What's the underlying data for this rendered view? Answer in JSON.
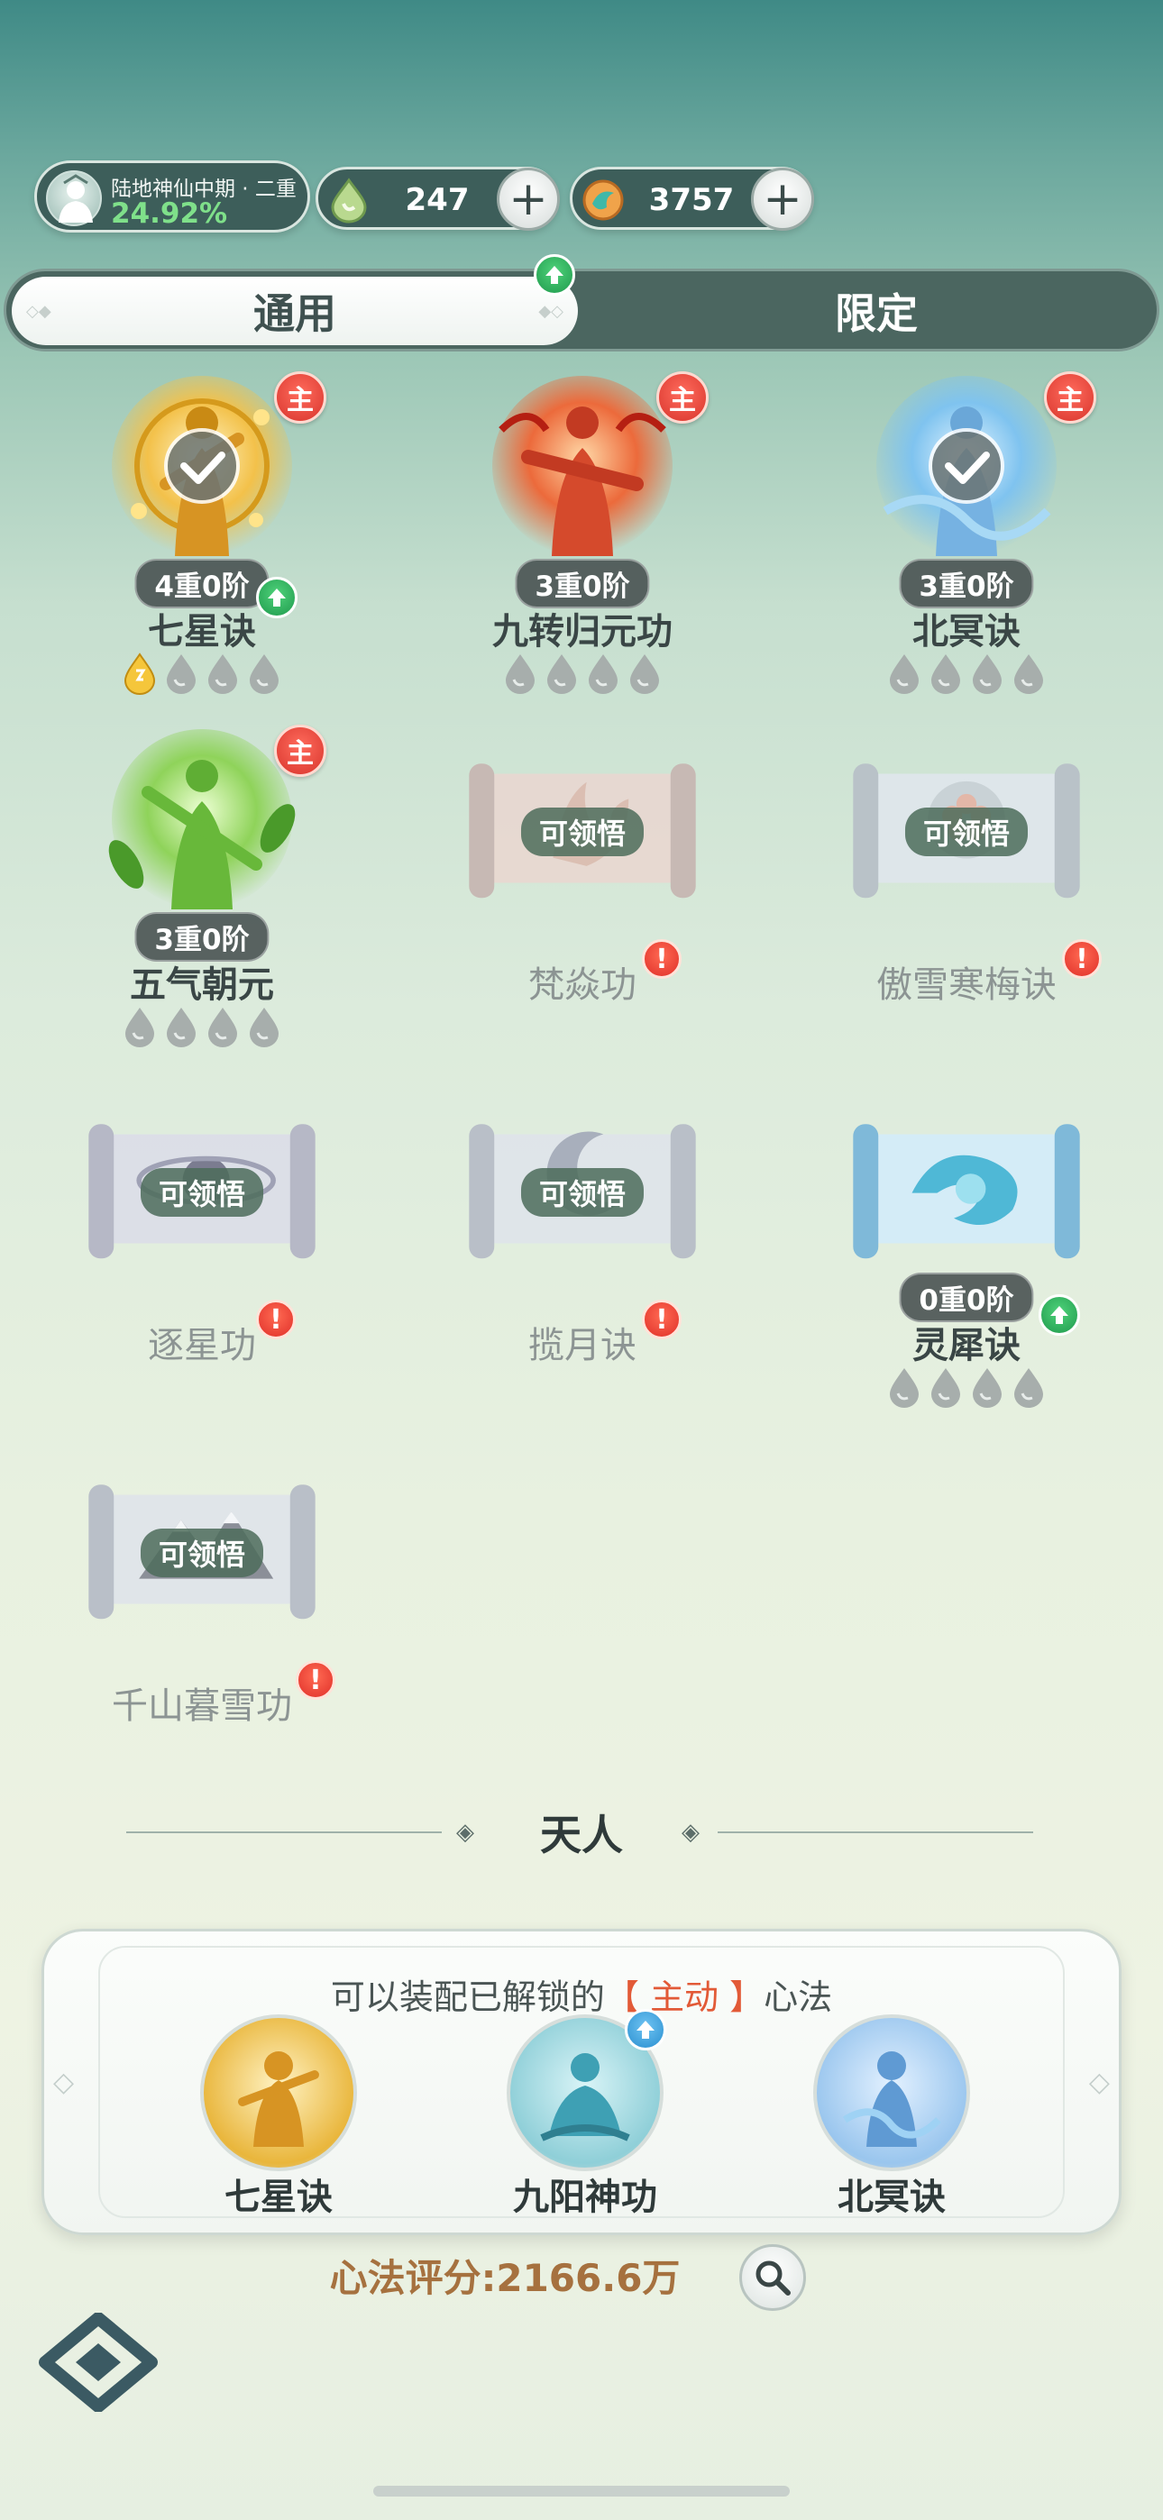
{
  "status": {
    "realm_name": "陆地神仙中期 · 二重",
    "realm_progress": "24.92%",
    "currency1_value": "247",
    "currency2_value": "3757"
  },
  "tabs": {
    "general": "通用",
    "limited": "限定"
  },
  "arts": [
    {
      "name": "七星诀",
      "level": "4重0阶",
      "main_tag": "主",
      "equipped": true,
      "filled_drops": 1
    },
    {
      "name": "九转归元功",
      "level": "3重0阶",
      "main_tag": "主",
      "equipped": false,
      "filled_drops": 0
    },
    {
      "name": "北冥诀",
      "level": "3重0阶",
      "main_tag": "主",
      "equipped": true,
      "filled_drops": 0
    },
    {
      "name": "五气朝元",
      "level": "3重0阶",
      "main_tag": "主",
      "equipped": false,
      "filled_drops": 0
    },
    {
      "name": "梵焱功",
      "claim": "可领悟",
      "alert": "!"
    },
    {
      "name": "傲雪寒梅诀",
      "claim": "可领悟",
      "alert": "!"
    },
    {
      "name": "逐星功",
      "claim": "可领悟",
      "alert": "!"
    },
    {
      "name": "揽月诀",
      "claim": "可领悟",
      "alert": "!"
    },
    {
      "name": "灵犀诀",
      "level": "0重0阶",
      "filled_drops": 0
    },
    {
      "name": "千山暮雪功",
      "claim": "可领悟",
      "alert": "!"
    }
  ],
  "section": {
    "title": "天人"
  },
  "panel": {
    "hint_prefix": "可以装配已解锁的",
    "hint_highlight": "【 主动 】",
    "hint_suffix": "心法",
    "slots": [
      "七星诀",
      "九阳神功",
      "北冥诀"
    ]
  },
  "score": {
    "label": "心法评分:2166.6万"
  },
  "colors": {
    "accent_red": "#d8352d",
    "upgrade_green": "#1f9a4d",
    "score_text": "#a6713f",
    "hint_highlight": "#e25a37"
  }
}
